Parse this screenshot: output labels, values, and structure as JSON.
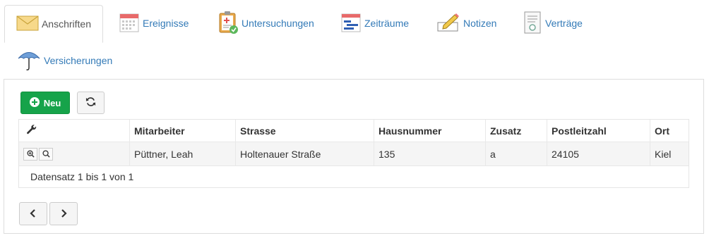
{
  "tabs": [
    {
      "label": "Anschriften",
      "icon": "envelope-icon",
      "active": true
    },
    {
      "label": "Ereignisse",
      "icon": "calendar-icon"
    },
    {
      "label": "Untersuchungen",
      "icon": "clipboard-medical-icon"
    },
    {
      "label": "Zeiträume",
      "icon": "timeline-icon"
    },
    {
      "label": "Notizen",
      "icon": "pencil-note-icon"
    },
    {
      "label": "Verträge",
      "icon": "contract-icon"
    },
    {
      "label": "Versicherungen",
      "icon": "umbrella-icon"
    }
  ],
  "toolbar": {
    "new_label": "Neu",
    "refresh_icon": "refresh-icon",
    "new_color": "#16a34a"
  },
  "table": {
    "columns": [
      "Mitarbeiter",
      "Strasse",
      "Hausnummer",
      "Zusatz",
      "Postleitzahl",
      "Ort"
    ],
    "tools_icon": "wrench-icon",
    "rows": [
      {
        "Mitarbeiter": "Püttner, Leah",
        "Strasse": "Holtenauer Straße",
        "Hausnummer": "135",
        "Zusatz": "a",
        "Postleitzahl": "24105",
        "Ort": "Kiel"
      }
    ],
    "footer": "Datensatz 1 bis 1 von 1"
  },
  "pager": {
    "prev_icon": "chevron-left-icon",
    "next_icon": "chevron-right-icon"
  }
}
